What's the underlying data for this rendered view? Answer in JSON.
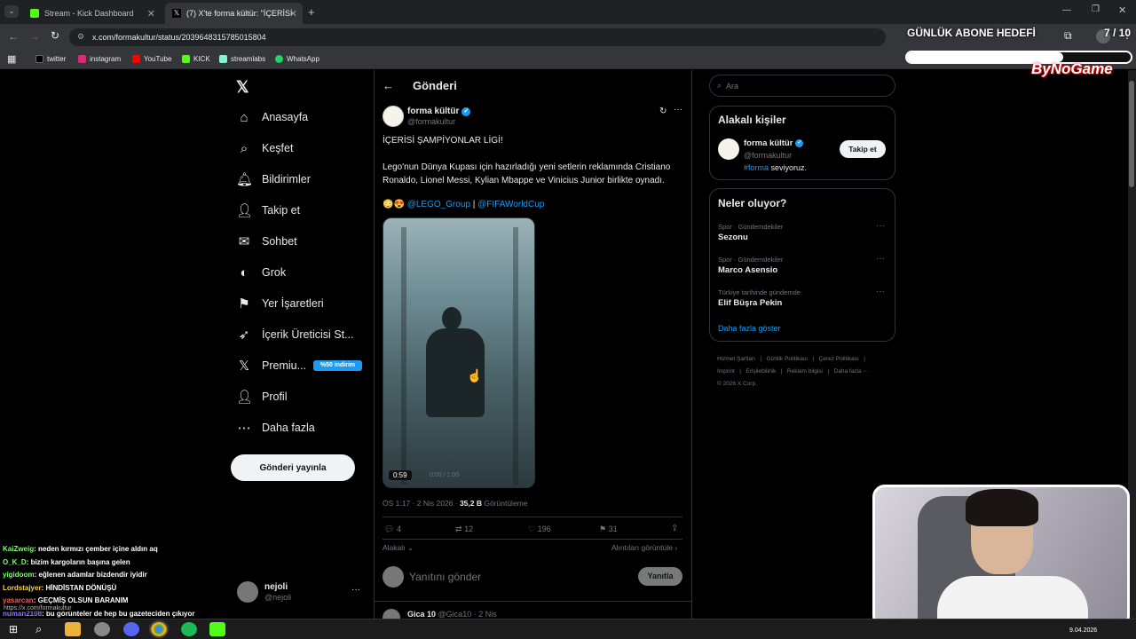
{
  "browser": {
    "tabs": [
      {
        "title": "Stream - Kick Dashboard"
      },
      {
        "title": "(7) X'te forma kültür: \"İÇERİSİ Ş…"
      }
    ],
    "new_tab": "+",
    "url": "x.com/formakultur/status/2039648315785015804",
    "bookmarks": [
      "twitter",
      "instagram",
      "YouTube",
      "KICK",
      "streamlabs",
      "WhatsApp"
    ]
  },
  "overlay": {
    "sub_goal_title": "GÜNLÜK ABONE HEDEFİ",
    "sub_goal_count": "7 / 10",
    "sub_goal_progress": 0.7,
    "brand": "ByNoGame"
  },
  "sidebar": {
    "items": [
      {
        "label": "Anasayfa",
        "icon": "home-icon"
      },
      {
        "label": "Keşfet",
        "icon": "search-icon"
      },
      {
        "label": "Bildirimler",
        "icon": "bell-icon"
      },
      {
        "label": "Takip et",
        "icon": "follow-icon"
      },
      {
        "label": "Sohbet",
        "icon": "chat-icon"
      },
      {
        "label": "Grok",
        "icon": "grok-icon"
      },
      {
        "label": "Yer İşaretleri",
        "icon": "bookmark-icon"
      },
      {
        "label": "İçerik Üreticisi St...",
        "icon": "rocket-icon"
      },
      {
        "label": "Premiu...",
        "icon": "x-logo-icon"
      },
      {
        "label": "Profil",
        "icon": "person-icon"
      },
      {
        "label": "Daha fazla",
        "icon": "more-circle-icon"
      }
    ],
    "premium_badge": "%50 indirim",
    "post_button": "Gönderi yayınla",
    "account_name": "nejoli",
    "account_handle": "@nejoli",
    "more": "···"
  },
  "main": {
    "header_title": "Gönderi",
    "author_name": "forma kültür",
    "author_handle": "@formakultur",
    "text_line1": "İÇERİSİ ŞAMPİYONLAR LİGİ!",
    "text_line2": "Lego'nun Dünya Kupası için hazırladığı yeni setlerin reklamında Cristiano Ronaldo, Lionel Messi, Kylian Mbappe ve Vinicius Junior birlikte oynadı.",
    "emojis": "😳😍",
    "mention1": "@LEGO_Group",
    "divider": "|",
    "mention2": "@FIFAWorldCup",
    "video_duration": "0:59",
    "video_time": "0:00 / 1:00",
    "meta_time": "ÖS 1:17 · 2 Nis 2026 · ",
    "meta_views": "35,2 B",
    "meta_views_label": " Görüntüleme",
    "stats": {
      "replies": "4",
      "reposts": "12",
      "likes": "196",
      "bookmarks": "31"
    },
    "relevant": "Alakalı",
    "quotes_link": "Alıntıları görüntüle ›",
    "reply_placeholder": "Yanıtını gönder",
    "reply_button": "Yanıtla",
    "next_author": "Gica 10",
    "next_handle": "@Gica10 · 2 Nis"
  },
  "right": {
    "search_placeholder": "Ara",
    "relevant_title": "Alakalı kişiler",
    "rel_name": "forma kültür",
    "rel_handle": "@formakultur",
    "rel_bio_tag": "#forma",
    "rel_bio_rest": " seviyoruz.",
    "follow_button": "Takip et",
    "trends_title": "Neler oluyor?",
    "trends": [
      {
        "context": "Spor · Gündemdekiler",
        "name": "Sezonu"
      },
      {
        "context": "Spor · Gündemdekiler",
        "name": "Marco Asensio"
      },
      {
        "context": "Türkiye tarihinde gündemde",
        "name": "Elif Büşra Pekin"
      }
    ],
    "show_more": "Daha fazla göster",
    "footer_line1": [
      "Hizmet Şartları",
      "Gizlilik Politikası",
      "Çerez Politikası"
    ],
    "footer_line2": [
      "Imprint",
      "Erişilebilirlik",
      "Reklam bilgisi",
      "Daha fazla ···"
    ],
    "copyright": "© 2026 X Corp."
  },
  "stream_chat": [
    {
      "user": "KaiZweig",
      "color": "#7cff6b",
      "msg": ": neden kırmızı çember içine aldın aq"
    },
    {
      "user": "O_K_D",
      "color": "#7cff6b",
      "msg": ": bizim kargoların başına gelen"
    },
    {
      "user": "yigidoom",
      "color": "#7cff6b",
      "msg": ": eğlenen adamlar bizdendir iyidir"
    },
    {
      "user": "Lordstajyer",
      "color": "#ffd23f",
      "msg": ": HİNDİSTAN DÖNÜŞÜ"
    },
    {
      "user": "yasarcan",
      "color": "#ff5a5a",
      "msg": ": GEÇMİŞ OLSUN BARANIM"
    },
    {
      "user": "numan2108",
      "color": "#8a7bff",
      "msg": ": bu görünteler de hep bu gazeteciden çıkıyor"
    }
  ],
  "status_url": "https://x.com/formakultur",
  "taskbar_date": "9.04.2026"
}
